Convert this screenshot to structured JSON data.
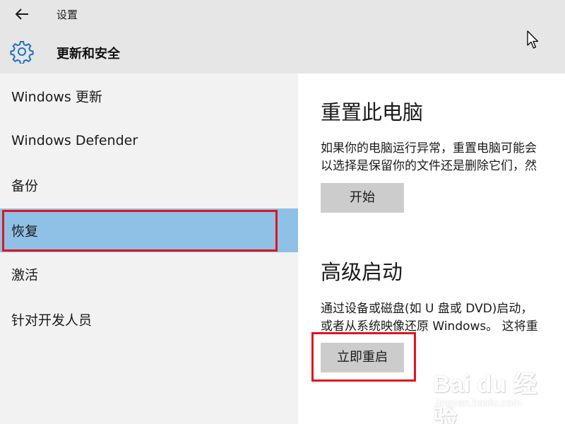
{
  "window": {
    "title": "设置",
    "back_icon": "back-arrow-icon"
  },
  "header": {
    "icon": "gear-icon",
    "title": "更新和安全"
  },
  "sidebar": {
    "items": [
      {
        "label": "Windows 更新"
      },
      {
        "label": "Windows Defender"
      },
      {
        "label": "备份"
      },
      {
        "label": "恢复",
        "selected": true
      },
      {
        "label": "激活"
      },
      {
        "label": "针对开发人员"
      }
    ],
    "selected_color": "#8fc1e6"
  },
  "main": {
    "reset": {
      "heading": "重置此电脑",
      "line1": "如果你的电脑运行异常，重置电脑可能会",
      "line2": "以选择是保留你的文件还是删除它们，然",
      "button": "开始"
    },
    "advanced": {
      "heading": "高级启动",
      "line1": "通过设备或磁盘(如 U 盘或 DVD)启动，",
      "line2": "或者从系统映像还原 Windows。 这将重",
      "button": "立即重启"
    }
  },
  "annotation_color": "#e0141e",
  "watermark": {
    "brand": "Bai du 经验",
    "url": "jingyan.baidu.com"
  }
}
